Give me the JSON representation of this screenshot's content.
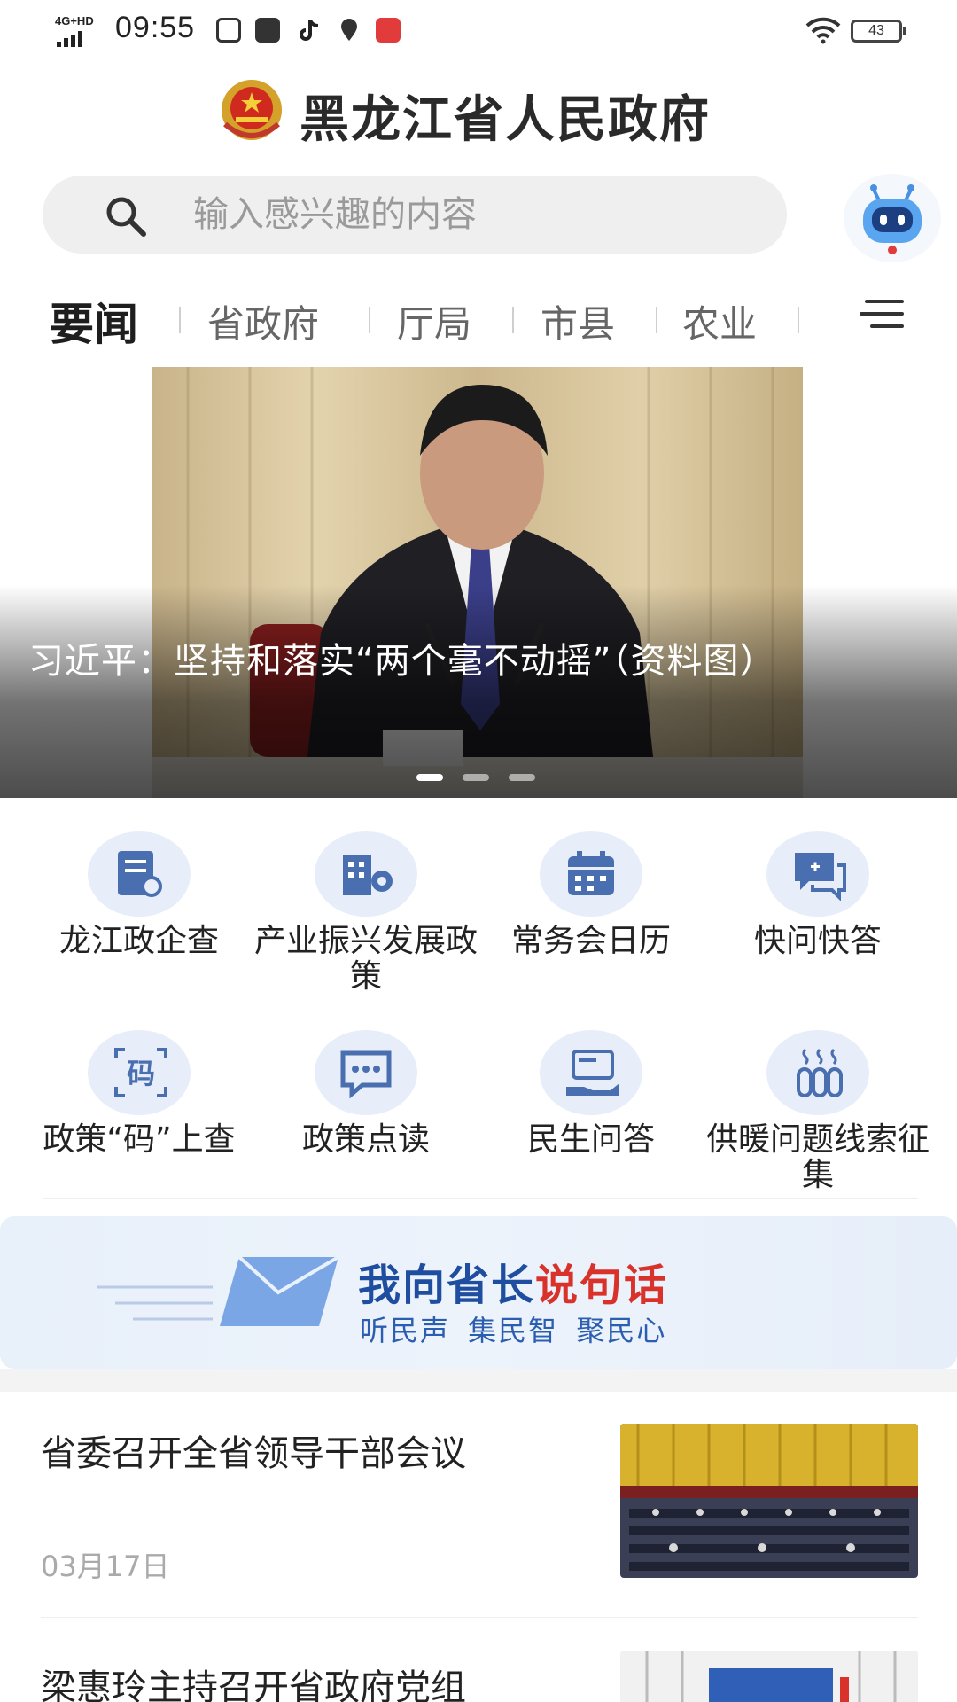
{
  "status_bar": {
    "network": "4G+HD",
    "time": "09:55",
    "battery": "43",
    "app_icons": [
      "grid-app-icon",
      "mail-icon",
      "tiktok-icon",
      "location-pin-icon",
      "red-app-icon"
    ]
  },
  "header": {
    "title": "黑龙江省人民政府"
  },
  "search": {
    "placeholder": "输入感兴趣的内容"
  },
  "tabs": [
    {
      "label": "要闻",
      "active": true
    },
    {
      "label": "省政府",
      "active": false
    },
    {
      "label": "厅局",
      "active": false
    },
    {
      "label": "市县",
      "active": false
    },
    {
      "label": "农业",
      "active": false
    }
  ],
  "banner": {
    "caption": "习近平：坚持和落实“两个毫不动摇”（资料图）",
    "slide_count": 3,
    "active_slide": 1
  },
  "services": [
    {
      "label": "龙江政企查",
      "icon": "document-search-icon"
    },
    {
      "label": "产业振兴发展政策",
      "icon": "building-gear-icon"
    },
    {
      "label": "常务会日历",
      "icon": "calendar-icon"
    },
    {
      "label": "快问快答",
      "icon": "chat-plus-icon"
    },
    {
      "label": "政策“码”上查",
      "icon": "qr-code-icon"
    },
    {
      "label": "政策点读",
      "icon": "chat-bubble-icon"
    },
    {
      "label": "民生问答",
      "icon": "hand-card-icon"
    },
    {
      "label": "供暖问题线索征集",
      "icon": "heating-icon"
    }
  ],
  "gov_banner": {
    "title_part1": "我向省长",
    "title_part2": "说句话",
    "subtitle": "听民声  集民智  聚民心"
  },
  "news": [
    {
      "title": "省委召开全省领导干部会议",
      "date": "03月17日"
    },
    {
      "title": "梁惠玲主持召开省政府党组",
      "date": ""
    }
  ],
  "colors": {
    "accent_blue": "#1f4ea0",
    "accent_red": "#d8322b",
    "icon_bg": "#e7eef9",
    "icon_fg": "#4a6fb0"
  }
}
